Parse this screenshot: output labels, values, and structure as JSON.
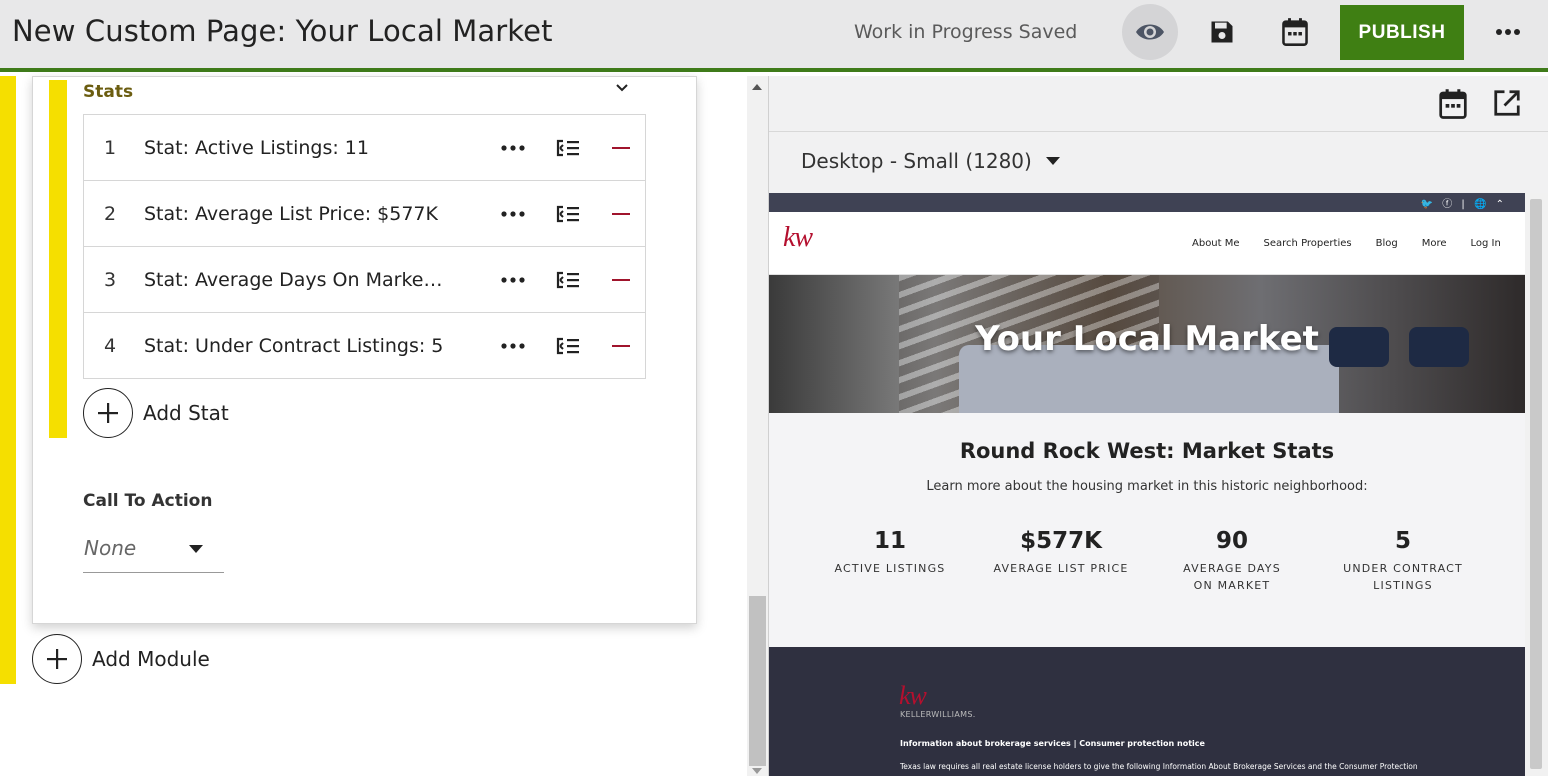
{
  "header": {
    "title": "New Custom Page: Your Local Market",
    "status": "Work in Progress Saved",
    "publish_label": "PUBLISH",
    "icons": [
      "eye-icon",
      "save-icon",
      "calendar-icon",
      "more-horizontal-icon"
    ]
  },
  "editor": {
    "section_heading": "Stats",
    "stats": [
      {
        "index": "1",
        "label": "Stat: Active Listings: 11"
      },
      {
        "index": "2",
        "label": "Stat: Average List Price: $577K"
      },
      {
        "index": "3",
        "label": "Stat: Average Days On Market:..."
      },
      {
        "index": "4",
        "label": "Stat: Under Contract Listings: 5"
      }
    ],
    "add_stat_label": "Add Stat",
    "cta_heading": "Call To Action",
    "cta_value": "None",
    "add_module_label": "Add Module"
  },
  "preview": {
    "device_label": "Desktop - Small (1280)",
    "site": {
      "logo_text": "kw",
      "nav": [
        "About Me",
        "Search Properties",
        "Blog",
        "More",
        "Log In"
      ],
      "hero_title": "Your Local Market",
      "market_title": "Round Rock West: Market Stats",
      "market_subtitle": "Learn more about the housing market in this historic neighborhood:",
      "stats": [
        {
          "value": "11",
          "caption_1": "ACTIVE LISTINGS",
          "caption_2": ""
        },
        {
          "value": "$577K",
          "caption_1": "AVERAGE LIST PRICE",
          "caption_2": ""
        },
        {
          "value": "90",
          "caption_1": "AVERAGE DAYS",
          "caption_2": "ON MARKET"
        },
        {
          "value": "5",
          "caption_1": "UNDER CONTRACT",
          "caption_2": "LISTINGS"
        }
      ],
      "footer_logo": "kw",
      "footer_brand": "KELLERWILLIAMS.",
      "footer_links": "Information about brokerage services  |  Consumer protection notice",
      "footer_legal": "Texas law requires all real estate license holders to give the following Information About Brokerage Services and the Consumer Protection"
    }
  },
  "colors": {
    "accent_green": "#3f7f13",
    "highlight_yellow": "#f5df00",
    "remove_red": "#a0142c",
    "kw_red": "#b40f2e"
  }
}
